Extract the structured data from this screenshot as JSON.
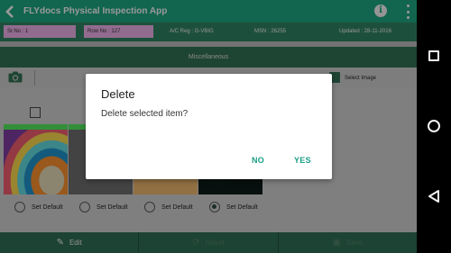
{
  "appbar": {
    "title": "FLYdocs Physical Inspection App",
    "info_glyph": "i"
  },
  "infobar": {
    "sr_no": "Sr.No : 1",
    "row_no": "Row No : 127",
    "ac_reg": "A/C Reg :  G-VBIG",
    "msn": "MSN :  26255",
    "updated": "Updated :  28-11-2016"
  },
  "section": {
    "title": "Miscellaneous"
  },
  "toolbar": {
    "select_image_label": "Select Image"
  },
  "images": [
    {
      "label": "Set Default",
      "selected": false
    },
    {
      "label": "Set Default",
      "selected": false
    },
    {
      "label": "Set Default",
      "selected": false
    },
    {
      "label": "Set Default",
      "selected": true
    }
  ],
  "bottombar": {
    "edit": "Edit",
    "reset": "Reset",
    "save": "Save"
  },
  "dialog": {
    "title": "Delete",
    "message": "Delete selected item?",
    "no_label": "NO",
    "yes_label": "YES"
  },
  "colors": {
    "primary": "#1d9e7b",
    "dark": "#2d6a50",
    "accent": "#1b9e86",
    "chip": "#e5a9e0"
  }
}
